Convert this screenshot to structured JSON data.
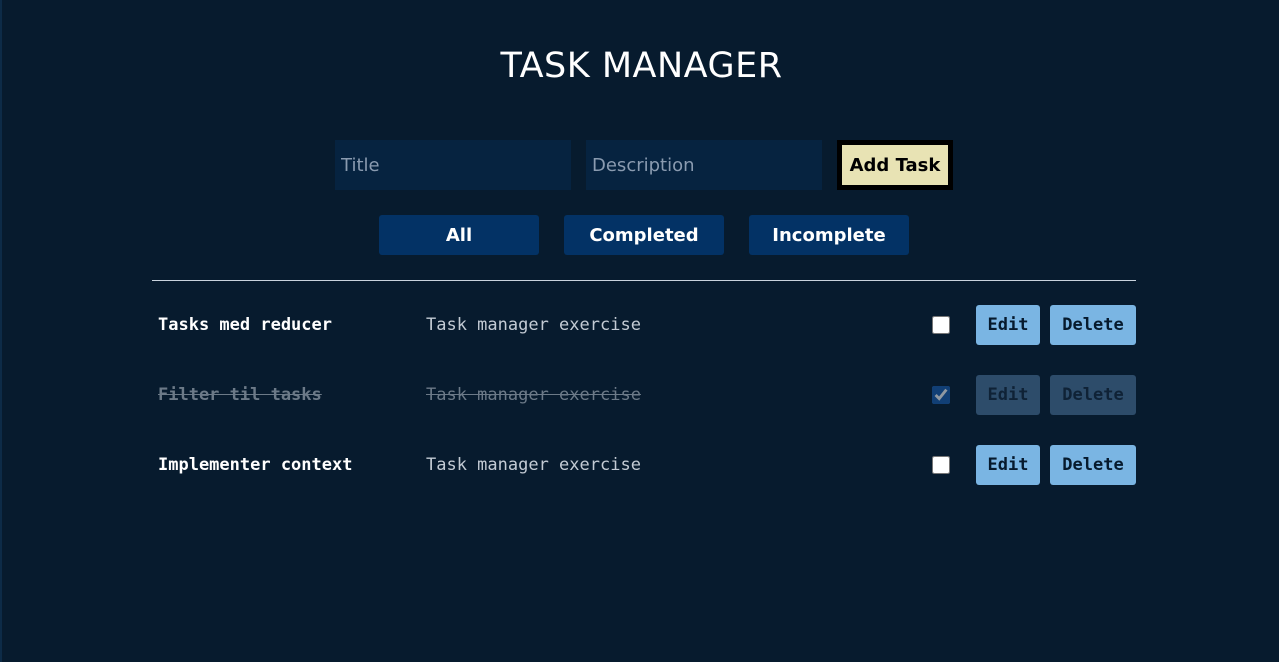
{
  "header": {
    "title": "TASK MANAGER"
  },
  "form": {
    "title_placeholder": "Title",
    "description_placeholder": "Description",
    "add_label": "Add Task"
  },
  "filters": {
    "all": "All",
    "completed": "Completed",
    "incomplete": "Incomplete"
  },
  "tasks": [
    {
      "title": "Tasks med reducer",
      "description": "Task manager exercise",
      "completed": false,
      "edit": "Edit",
      "delete": "Delete"
    },
    {
      "title": "Filter til tasks",
      "description": "Task manager exercise",
      "completed": true,
      "edit": "Edit",
      "delete": "Delete"
    },
    {
      "title": "Implementer context",
      "description": "Task manager exercise",
      "completed": false,
      "edit": "Edit",
      "delete": "Delete"
    }
  ],
  "colors": {
    "background": "#071b2e",
    "input_bg": "#062340",
    "add_button_bg": "#e8e3b4",
    "filter_button_bg": "#033265",
    "action_button_bg": "#7ab5e3",
    "action_button_disabled_bg": "#2d4c6a"
  }
}
